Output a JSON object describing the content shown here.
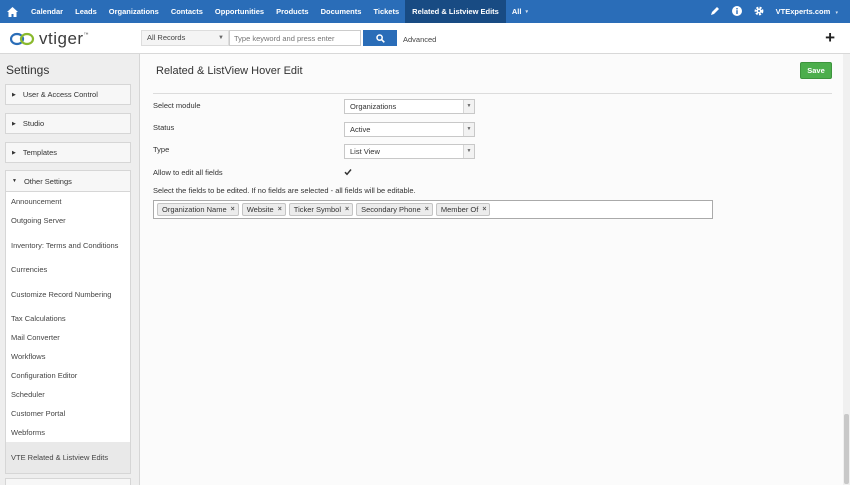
{
  "nav": {
    "items": [
      "Calendar",
      "Leads",
      "Organizations",
      "Contacts",
      "Opportunities",
      "Products",
      "Documents",
      "Tickets",
      "Related & Listview Edits",
      "All"
    ],
    "active_index": 8,
    "user": "VTExperts.com"
  },
  "header": {
    "logo_text": "vtiger",
    "logo_sup": "™",
    "records_select": "All Records",
    "search_placeholder": "Type keyword and press enter",
    "advanced": "Advanced"
  },
  "sidebar": {
    "title": "Settings",
    "sections": [
      "User & Access Control",
      "Studio",
      "Templates",
      "Other Settings"
    ],
    "sub_items": [
      "Announcement",
      "Outgoing Server",
      "Inventory: Terms and Conditions",
      "Currencies",
      "Customize Record Numbering",
      "Tax Calculations",
      "Mail Converter",
      "Workflows",
      "Configuration Editor",
      "Scheduler",
      "Customer Portal",
      "Webforms",
      "VTE Related & Listview Edits"
    ]
  },
  "main": {
    "title": "Related & ListView Hover Edit",
    "save_label": "Save",
    "module_label": "Select module",
    "module_value": "Organizations",
    "status_label": "Status",
    "status_value": "Active",
    "type_label": "Type",
    "type_value": "List View",
    "allow_label": "Allow to edit all fields",
    "allow_checked": true,
    "hint": "Select the fields to be edited. If no fields are selected - all fields will be editable.",
    "fields": [
      "Organization Name",
      "Website",
      "Ticker Symbol",
      "Secondary Phone",
      "Member Of"
    ]
  },
  "colors": {
    "nav_bg": "#2a6db8",
    "nav_active": "#184b83",
    "save_green": "#4cae4c"
  }
}
